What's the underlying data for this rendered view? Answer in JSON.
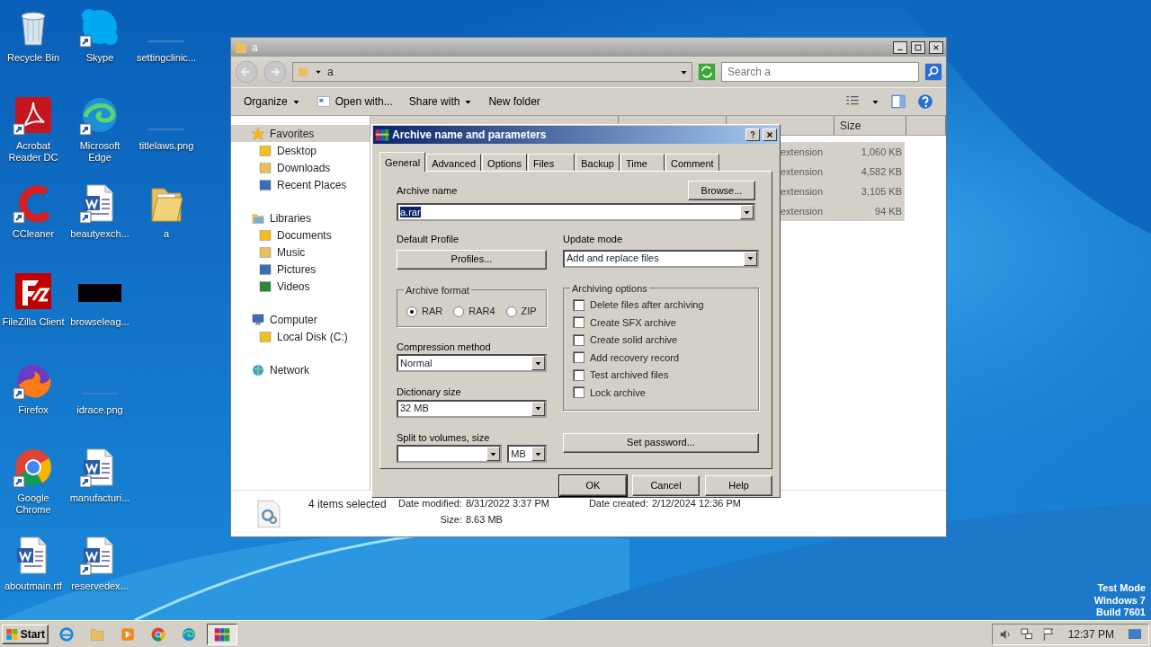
{
  "desktop_icons": [
    {
      "label": "Recycle Bin"
    },
    {
      "label": "Acrobat Reader DC"
    },
    {
      "label": "CCleaner"
    },
    {
      "label": "FileZilla Client"
    },
    {
      "label": "Firefox"
    },
    {
      "label": "Google Chrome"
    },
    {
      "label": "aboutmain.rtf"
    },
    {
      "label": "Skype"
    },
    {
      "label": "Microsoft Edge"
    },
    {
      "label": "beautyexch..."
    },
    {
      "label": "browseleag..."
    },
    {
      "label": "idrace.png"
    },
    {
      "label": "manufacturi..."
    },
    {
      "label": "reservedex..."
    },
    {
      "label": "settingclinic..."
    },
    {
      "label": "titlelaws.png"
    },
    {
      "label": "a"
    }
  ],
  "explorer": {
    "title": "a",
    "address": "a",
    "search": {
      "placeholder": "Search a"
    },
    "toolbar": [
      {
        "label": "Organize",
        "kind": "menu"
      },
      {
        "label": "Open with...",
        "kind": "icon"
      },
      {
        "label": "Share with",
        "kind": "menu"
      },
      {
        "label": "New folder",
        "kind": "plain"
      }
    ],
    "nav": [
      {
        "label": "Favorites",
        "selected": true,
        "children": [
          {
            "label": "Desktop",
            "selected": false
          },
          {
            "label": "Downloads",
            "selected": false
          },
          {
            "label": "Recent Places",
            "selected": false
          }
        ]
      },
      {
        "label": "Libraries",
        "selected": false,
        "children": [
          {
            "label": "Documents",
            "selected": false
          },
          {
            "label": "Music",
            "selected": false
          },
          {
            "label": "Pictures",
            "selected": false
          },
          {
            "label": "Videos",
            "selected": false
          }
        ]
      },
      {
        "label": "Computer",
        "selected": false,
        "children": [
          {
            "label": "Local Disk (C:)",
            "selected": false
          }
        ]
      },
      {
        "label": "Network",
        "selected": false
      }
    ],
    "columns": [
      {
        "label": "Size"
      }
    ],
    "rows": [
      {
        "type": "extension",
        "size": "1,060 KB",
        "selected": true
      },
      {
        "type": "extension",
        "size": "4,582 KB",
        "selected": true
      },
      {
        "type": "extension",
        "size": "3,105 KB",
        "selected": true
      },
      {
        "type": "extension",
        "size": "94 KB",
        "selected": true
      }
    ],
    "details": {
      "summary": "4 items selected",
      "fields": [
        {
          "label": "Date modified:",
          "value": "8/31/2022 3:37 PM"
        },
        {
          "label": "Date created:",
          "value": "2/12/2024 12:36 PM"
        },
        {
          "label": "Size:",
          "value": "8.63 MB"
        }
      ]
    }
  },
  "dialog": {
    "title": "Archive name and parameters",
    "tabs": [
      {
        "label": "General",
        "selected": true
      },
      {
        "label": "Advanced",
        "selected": false
      },
      {
        "label": "Options",
        "selected": false
      },
      {
        "label": "Files",
        "selected": false
      },
      {
        "label": "Backup",
        "selected": false
      },
      {
        "label": "Time",
        "selected": false
      },
      {
        "label": "Comment",
        "selected": false
      }
    ],
    "archive_name": {
      "label": "Archive name",
      "value": "a.rar",
      "browse": "Browse..."
    },
    "profile": {
      "label": "Default Profile",
      "button": "Profiles..."
    },
    "update_mode": {
      "label": "Update mode",
      "value": "Add and replace files"
    },
    "format": {
      "label": "Archive format",
      "options": [
        {
          "label": "RAR",
          "selected": true
        },
        {
          "label": "RAR4",
          "selected": false
        },
        {
          "label": "ZIP",
          "selected": false
        }
      ]
    },
    "compression": {
      "label": "Compression method",
      "value": "Normal"
    },
    "dictionary": {
      "label": "Dictionary size",
      "value": "32 MB"
    },
    "split": {
      "label": "Split to volumes, size",
      "unit": "MB"
    },
    "options": {
      "label": "Archiving options",
      "items": [
        {
          "label": "Delete files after archiving",
          "checked": false
        },
        {
          "label": "Create SFX archive",
          "checked": false
        },
        {
          "label": "Create solid archive",
          "checked": false
        },
        {
          "label": "Add recovery record",
          "checked": false
        },
        {
          "label": "Test archived files",
          "checked": false
        },
        {
          "label": "Lock archive",
          "checked": false
        }
      ]
    },
    "password_button": "Set password...",
    "buttons": [
      {
        "label": "OK",
        "default": true
      },
      {
        "label": "Cancel",
        "default": false
      },
      {
        "label": "Help",
        "default": false
      }
    ]
  },
  "system_notice": [
    "Test Mode",
    "Windows 7",
    "Build 7601"
  ],
  "taskbar": {
    "start": "Start",
    "apps": [
      {
        "selected": false
      },
      {
        "selected": false
      },
      {
        "selected": false
      },
      {
        "selected": false
      },
      {
        "selected": false
      },
      {
        "selected": true
      }
    ],
    "time": "12:37 PM"
  }
}
